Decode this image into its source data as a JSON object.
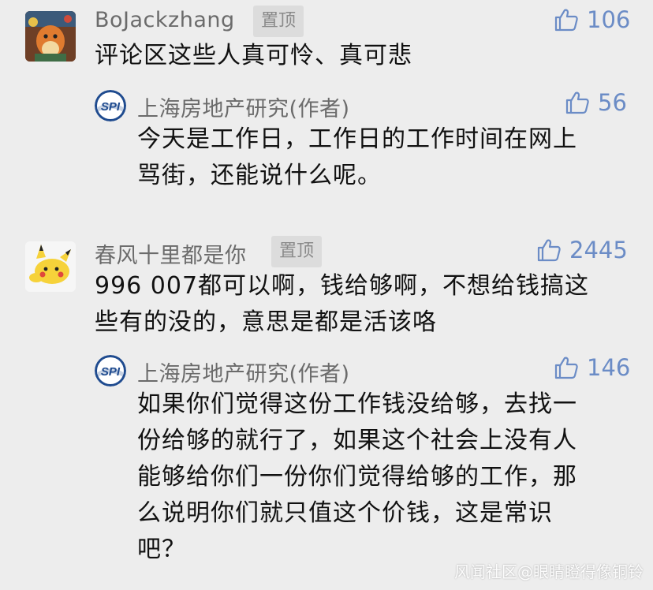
{
  "comments": [
    {
      "user": "BoJackzhang",
      "badge": "置顶",
      "likes": "106",
      "text": "评论区这些人真可怜、真可悲",
      "reply": {
        "user": "上海房地产研究(作者)",
        "likes": "56",
        "text_lines": [
          "今天是工作日，工作日的工作时间在网上",
          "骂街，还能说什么呢。"
        ]
      }
    },
    {
      "user": "春风十里都是你",
      "badge": "置顶",
      "likes": "2445",
      "text_lines": [
        "996 007都可以啊，钱给够啊，不想给钱搞这",
        "些有的没的，意思是都是活该咯"
      ],
      "reply": {
        "user": "上海房地产研究(作者)",
        "likes": "146",
        "text_lines": [
          "如果你们觉得这份工作钱没给够，去找一",
          "份给够的就行了，如果这个社会上没有人",
          "能够给你们一份你们觉得给够的工作，那",
          "么说明你们就只值这个价钱，这是常识",
          "吧？"
        ]
      }
    }
  ],
  "author_logo_text": "SPI",
  "watermark": "风闻社区@眼睛瞪得像铜铃",
  "colors": {
    "background": "#ededed",
    "like": "#6b8cc6",
    "name": "#6b6b6b",
    "text": "#111111"
  }
}
